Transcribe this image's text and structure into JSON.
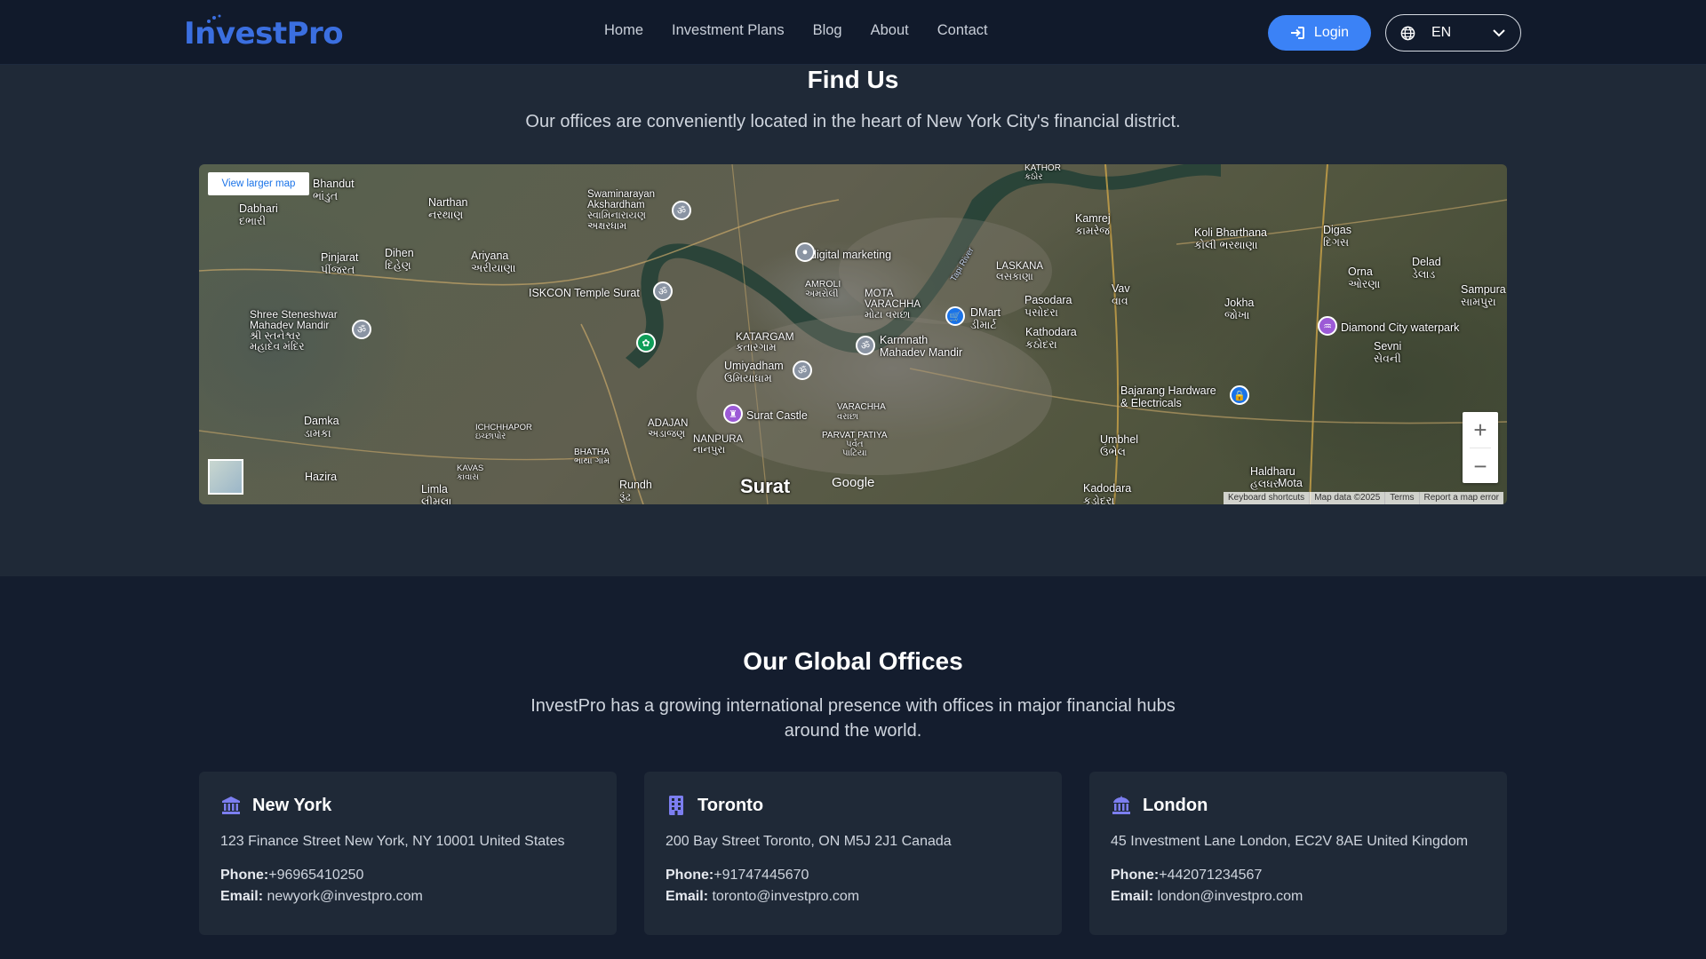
{
  "header": {
    "logo_text": "InvestPro",
    "nav": [
      "Home",
      "Investment Plans",
      "Blog",
      "About",
      "Contact"
    ],
    "login_label": "Login",
    "language": "EN"
  },
  "find_us": {
    "title": "Find Us",
    "subtitle": "Our offices are conveniently located in the heart of New York City's financial district."
  },
  "map": {
    "view_larger": "View larger map",
    "labels": {
      "bhandut": "Bhandut\nભાંડુત",
      "dabhari": "Dabhari\nદભારી",
      "narthan": "Narthan\nનરથાણ",
      "swaminarayan": "Swaminarayan\nAkshardham\nસ્વામિનારાયણ\nઅક્ષરધામ",
      "pinjarat": "Pinjarat\nપીંજરત",
      "dihen": "Dihen\nદિહેણ",
      "ariyana": "Ariyana\nઅરીયાણા",
      "iskcon": "ISKCON Temple Surat",
      "digital_marketing": "digital marketing",
      "amroli": "AMROLI\nઅમરોલી",
      "mota_varachha": "MOTA\nVARACHHA\nમોટા વરાછા",
      "laskana": "LASKANA\nલસકાણા",
      "kamrej": "Kamrej\nકામરેજ",
      "kathor": "KATHOR\nકઠોર",
      "koli_bharthana": "Koli Bharthana\nકોલી ભરથાણા",
      "digas": "Digas\nદિગસ",
      "delad": "Delad\nડેલાડ",
      "orna": "Orna\nઓરણા",
      "sampura": "Sampura\nસામપુરા",
      "shree_steneshwar": "Shree Steneshwar\nMahadev Mandir\nશ્રી સ્તનેશ્વર\nમહાદેવ મંદિર",
      "katargam": "KATARGAM\nકતારગામ",
      "karmnath": "Karmnath\nMahadev Mandir",
      "dmart": "DMart\nડીમાર્ટ",
      "pasodara": "Pasodara\nપસોદરા",
      "vav": "Vav\nવાવ",
      "jokha": "Jokha\nજોખા",
      "kathodara": "Kathodara\nકઠોદરા",
      "diamond_city": "Diamond City waterpark",
      "sevni": "Sevni\nસેવની",
      "umiyadham": "Umiyadham\nઉમિયાધામ",
      "bajarang": "Bajarang Hardware\n& Electricals",
      "damka": "Damka\nડામકા",
      "ichchhapor": "ICHCHHAPOR\nઇચ્છાપોર",
      "adajan": "ADAJAN\nઅડાજણ",
      "surat_castle": "Surat Castle",
      "varachha": "VARACHHA\nવરાછા",
      "nanpura": "NANPURA\nનાનપુરા",
      "parvat_patiya": "PARVAT PATIYA\nપર્વત\nપાટિયા",
      "umbhel": "Umbhel\nઉંભેલ",
      "bhatha": "BHATHA\nભાથા ગામ",
      "kavas": "KAVAS\nકાવાસ",
      "hazira": "Hazira",
      "limla": "Limla\nલીમલા",
      "rundh": "Rundh\nરૂંઢ",
      "surat": "Surat",
      "haldharu": "Haldharu\nહલધરુ",
      "kadodara": "Kadodara\nકડોદરા",
      "mota": "Mota",
      "tapi_river": "Tapi River"
    },
    "google": "Google",
    "footer": [
      "Keyboard shortcuts",
      "Map data ©2025",
      "Terms",
      "Report a map error"
    ]
  },
  "offices": {
    "title": "Our Global Offices",
    "subtitle": "InvestPro has a growing international presence with offices in major financial hubs around the world.",
    "phone_label": "Phone:",
    "email_label": "Email:",
    "cards": [
      {
        "city": "New York",
        "icon": "bank-icon",
        "address": "123 Finance Street New York, NY 10001 United States",
        "phone": "+96965410250",
        "email": "newyork@investpro.com"
      },
      {
        "city": "Toronto",
        "icon": "building-icon",
        "address": "200 Bay Street Toronto, ON M5J 2J1 Canada",
        "phone": "+91747445670",
        "email": "toronto@investpro.com"
      },
      {
        "city": "London",
        "icon": "bank-icon",
        "address": "45 Investment Lane London, EC2V 8AE United Kingdom",
        "phone": "+442071234567",
        "email": "london@investpro.com"
      }
    ]
  },
  "colors": {
    "accent": "#3b82f6",
    "icon": "#7c7ef0",
    "card_bg": "#1f2937",
    "page_bg": "#141d2e"
  }
}
